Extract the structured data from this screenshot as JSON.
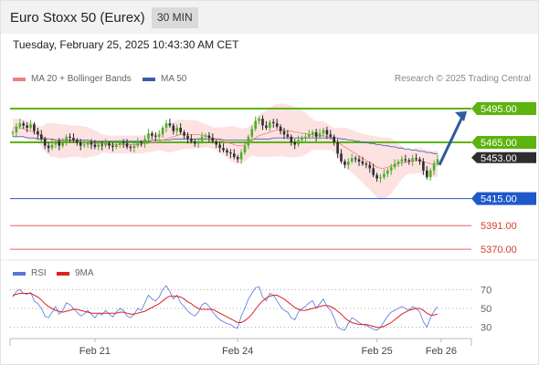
{
  "header": {
    "title": "Euro Stoxx 50 (Eurex)",
    "interval": "30 MIN",
    "timestamp": "Tuesday, February 25, 2025 10:43:30 AM CET"
  },
  "legend": {
    "ma20": "MA 20 + Bollinger Bands",
    "ma50": "MA 50",
    "credit": "Research © 2025 Trading Central",
    "rsi": "RSI",
    "rsi_ma": "9MA"
  },
  "colors": {
    "ma20": "#f08080",
    "ma50": "#3a5ba8",
    "bull": "#4caf2a",
    "bear": "#2e2e2e",
    "band_fill": "#fde2e2",
    "level_green": "#5db30f",
    "level_blue": "#1f58c9",
    "level_red": "#e06666",
    "arrow": "#2e5b9a",
    "rsi": "#5577dd",
    "rsi_ma": "#dd2222"
  },
  "chart_data": [
    {
      "type": "line",
      "title": "Euro Stoxx 50 (Eurex)",
      "price_range": [
        5362,
        5508
      ],
      "x_ticks": [
        {
          "label": "Feb 21",
          "bar": 23
        },
        {
          "label": "Feb 24",
          "bar": 63
        },
        {
          "label": "Feb 25",
          "bar": 102
        },
        {
          "label": "Feb 26",
          "bar": 120
        }
      ],
      "levels": [
        {
          "value": 5495.0,
          "label": "5495.00",
          "kind": "resistance"
        },
        {
          "value": 5465.0,
          "label": "5465.00",
          "kind": "pivot"
        },
        {
          "value": 5415.0,
          "label": "5415.00",
          "kind": "support"
        },
        {
          "value": 5391.0,
          "label": "5391.00",
          "kind": "support2"
        },
        {
          "value": 5370.0,
          "label": "5370.00",
          "kind": "support3"
        }
      ],
      "last_price": {
        "value": 5453.0,
        "label": "5453.00"
      },
      "target_arrow": {
        "from": 5453,
        "to": 5495
      },
      "closes": [
        5474,
        5479,
        5482,
        5480,
        5478,
        5481,
        5475,
        5472,
        5468,
        5462,
        5460,
        5463,
        5466,
        5462,
        5465,
        5470,
        5469,
        5467,
        5465,
        5462,
        5463,
        5465,
        5463,
        5461,
        5463,
        5462,
        5464,
        5462,
        5461,
        5463,
        5465,
        5464,
        5461,
        5460,
        5462,
        5465,
        5464,
        5468,
        5473,
        5471,
        5470,
        5472,
        5478,
        5482,
        5480,
        5475,
        5478,
        5474,
        5471,
        5468,
        5466,
        5464,
        5466,
        5470,
        5471,
        5469,
        5466,
        5463,
        5460,
        5458,
        5456,
        5455,
        5452,
        5450,
        5456,
        5462,
        5470,
        5477,
        5484,
        5486,
        5480,
        5478,
        5483,
        5482,
        5479,
        5475,
        5472,
        5470,
        5465,
        5463,
        5467,
        5469,
        5470,
        5472,
        5474,
        5470,
        5473,
        5476,
        5472,
        5470,
        5465,
        5455,
        5448,
        5445,
        5448,
        5451,
        5450,
        5448,
        5446,
        5445,
        5442,
        5436,
        5433,
        5434,
        5437,
        5440,
        5443,
        5446,
        5448,
        5450,
        5449,
        5448,
        5451,
        5450,
        5448,
        5440,
        5434,
        5440,
        5446,
        5450
      ],
      "ma20": [
        5478,
        5478,
        5478,
        5477,
        5476,
        5475,
        5474,
        5472,
        5470,
        5469,
        5468,
        5467,
        5467,
        5466,
        5466,
        5466,
        5466,
        5466,
        5466,
        5466,
        5465,
        5465,
        5465,
        5464,
        5464,
        5464,
        5464,
        5463,
        5463,
        5463,
        5463,
        5463,
        5463,
        5463,
        5463,
        5463,
        5463,
        5464,
        5464,
        5465,
        5465,
        5466,
        5467,
        5468,
        5469,
        5470,
        5471,
        5472,
        5472,
        5472,
        5472,
        5472,
        5472,
        5471,
        5471,
        5470,
        5469,
        5468,
        5467,
        5466,
        5465,
        5464,
        5463,
        5462,
        5462,
        5463,
        5465,
        5467,
        5469,
        5471,
        5472,
        5473,
        5474,
        5475,
        5476,
        5476,
        5476,
        5475,
        5475,
        5474,
        5474,
        5473,
        5473,
        5472,
        5472,
        5471,
        5471,
        5471,
        5470,
        5469,
        5467,
        5465,
        5463,
        5461,
        5459,
        5457,
        5455,
        5453,
        5451,
        5449,
        5447,
        5445,
        5443,
        5442,
        5442,
        5443,
        5444,
        5445,
        5446,
        5447,
        5447,
        5448,
        5448,
        5449,
        5449,
        5448,
        5447,
        5446,
        5446,
        5446
      ],
      "ma50": [
        5470,
        5470,
        5470,
        5470,
        5469,
        5469,
        5469,
        5468,
        5468,
        5468,
        5468,
        5468,
        5467,
        5467,
        5467,
        5467,
        5467,
        5467,
        5467,
        5467,
        5467,
        5467,
        5466,
        5466,
        5466,
        5466,
        5466,
        5466,
        5466,
        5466,
        5466,
        5466,
        5466,
        5466,
        5466,
        5466,
        5466,
        5466,
        5466,
        5467,
        5467,
        5467,
        5467,
        5467,
        5467,
        5468,
        5468,
        5468,
        5468,
        5468,
        5468,
        5468,
        5468,
        5468,
        5468,
        5468,
        5468,
        5468,
        5468,
        5467,
        5467,
        5467,
        5467,
        5467,
        5467,
        5467,
        5467,
        5467,
        5468,
        5468,
        5468,
        5468,
        5468,
        5469,
        5469,
        5469,
        5469,
        5469,
        5469,
        5469,
        5469,
        5469,
        5469,
        5469,
        5469,
        5469,
        5469,
        5469,
        5469,
        5469,
        5469,
        5469,
        5468,
        5468,
        5467,
        5467,
        5466,
        5466,
        5465,
        5465,
        5464,
        5464,
        5463,
        5463,
        5462,
        5462,
        5461,
        5461,
        5460,
        5460,
        5459,
        5459,
        5458,
        5458,
        5457,
        5457,
        5456,
        5456,
        5455,
        5455
      ]
    },
    {
      "type": "line",
      "title": "RSI",
      "ylim": [
        20,
        80
      ],
      "y_ticks": [
        70,
        50,
        30
      ],
      "series": [
        {
          "name": "RSI",
          "values": [
            62,
            68,
            70,
            66,
            65,
            67,
            58,
            55,
            50,
            42,
            40,
            46,
            52,
            44,
            48,
            56,
            54,
            50,
            46,
            42,
            44,
            48,
            44,
            40,
            45,
            43,
            48,
            44,
            41,
            46,
            50,
            48,
            42,
            40,
            44,
            50,
            48,
            56,
            64,
            60,
            58,
            62,
            70,
            74,
            68,
            60,
            64,
            56,
            52,
            47,
            44,
            42,
            46,
            54,
            56,
            52,
            46,
            42,
            38,
            36,
            34,
            33,
            30,
            29,
            42,
            50,
            60,
            66,
            72,
            73,
            62,
            58,
            66,
            64,
            58,
            52,
            48,
            46,
            40,
            38,
            46,
            50,
            52,
            56,
            58,
            50,
            55,
            60,
            52,
            48,
            40,
            30,
            28,
            27,
            34,
            40,
            38,
            35,
            33,
            32,
            30,
            28,
            27,
            30,
            36,
            42,
            46,
            48,
            50,
            52,
            50,
            48,
            52,
            50,
            46,
            36,
            30,
            40,
            47,
            52
          ]
        },
        {
          "name": "9MA",
          "values": [
            64,
            65,
            66,
            66,
            66,
            66,
            64,
            62,
            59,
            55,
            52,
            50,
            48,
            47,
            46,
            47,
            48,
            49,
            49,
            48,
            47,
            46,
            45,
            45,
            45,
            45,
            45,
            45,
            45,
            45,
            46,
            46,
            45,
            44,
            44,
            45,
            46,
            47,
            49,
            51,
            53,
            55,
            58,
            61,
            63,
            63,
            63,
            62,
            60,
            57,
            55,
            52,
            50,
            49,
            49,
            49,
            49,
            47,
            45,
            43,
            41,
            39,
            37,
            35,
            35,
            37,
            40,
            44,
            49,
            54,
            58,
            61,
            63,
            64,
            64,
            62,
            60,
            57,
            54,
            51,
            49,
            48,
            48,
            49,
            50,
            51,
            52,
            53,
            53,
            52,
            50,
            47,
            44,
            40,
            37,
            35,
            34,
            33,
            33,
            33,
            32,
            31,
            30,
            30,
            31,
            33,
            35,
            38,
            41,
            44,
            46,
            48,
            49,
            50,
            50,
            48,
            45,
            43,
            43,
            44
          ]
        }
      ]
    }
  ]
}
